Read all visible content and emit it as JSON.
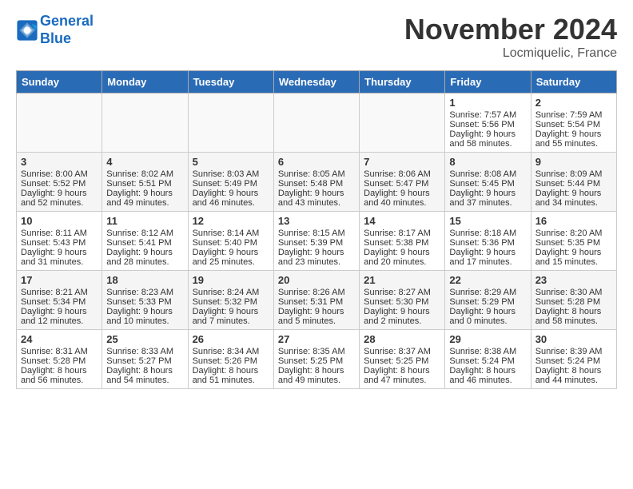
{
  "logo": {
    "line1": "General",
    "line2": "Blue"
  },
  "title": "November 2024",
  "location": "Locmiquelic, France",
  "headers": [
    "Sunday",
    "Monday",
    "Tuesday",
    "Wednesday",
    "Thursday",
    "Friday",
    "Saturday"
  ],
  "weeks": [
    [
      {
        "day": "",
        "content": ""
      },
      {
        "day": "",
        "content": ""
      },
      {
        "day": "",
        "content": ""
      },
      {
        "day": "",
        "content": ""
      },
      {
        "day": "",
        "content": ""
      },
      {
        "day": "1",
        "content": "Sunrise: 7:57 AM\nSunset: 5:56 PM\nDaylight: 9 hours and 58 minutes."
      },
      {
        "day": "2",
        "content": "Sunrise: 7:59 AM\nSunset: 5:54 PM\nDaylight: 9 hours and 55 minutes."
      }
    ],
    [
      {
        "day": "3",
        "content": "Sunrise: 8:00 AM\nSunset: 5:52 PM\nDaylight: 9 hours and 52 minutes."
      },
      {
        "day": "4",
        "content": "Sunrise: 8:02 AM\nSunset: 5:51 PM\nDaylight: 9 hours and 49 minutes."
      },
      {
        "day": "5",
        "content": "Sunrise: 8:03 AM\nSunset: 5:49 PM\nDaylight: 9 hours and 46 minutes."
      },
      {
        "day": "6",
        "content": "Sunrise: 8:05 AM\nSunset: 5:48 PM\nDaylight: 9 hours and 43 minutes."
      },
      {
        "day": "7",
        "content": "Sunrise: 8:06 AM\nSunset: 5:47 PM\nDaylight: 9 hours and 40 minutes."
      },
      {
        "day": "8",
        "content": "Sunrise: 8:08 AM\nSunset: 5:45 PM\nDaylight: 9 hours and 37 minutes."
      },
      {
        "day": "9",
        "content": "Sunrise: 8:09 AM\nSunset: 5:44 PM\nDaylight: 9 hours and 34 minutes."
      }
    ],
    [
      {
        "day": "10",
        "content": "Sunrise: 8:11 AM\nSunset: 5:43 PM\nDaylight: 9 hours and 31 minutes."
      },
      {
        "day": "11",
        "content": "Sunrise: 8:12 AM\nSunset: 5:41 PM\nDaylight: 9 hours and 28 minutes."
      },
      {
        "day": "12",
        "content": "Sunrise: 8:14 AM\nSunset: 5:40 PM\nDaylight: 9 hours and 25 minutes."
      },
      {
        "day": "13",
        "content": "Sunrise: 8:15 AM\nSunset: 5:39 PM\nDaylight: 9 hours and 23 minutes."
      },
      {
        "day": "14",
        "content": "Sunrise: 8:17 AM\nSunset: 5:38 PM\nDaylight: 9 hours and 20 minutes."
      },
      {
        "day": "15",
        "content": "Sunrise: 8:18 AM\nSunset: 5:36 PM\nDaylight: 9 hours and 17 minutes."
      },
      {
        "day": "16",
        "content": "Sunrise: 8:20 AM\nSunset: 5:35 PM\nDaylight: 9 hours and 15 minutes."
      }
    ],
    [
      {
        "day": "17",
        "content": "Sunrise: 8:21 AM\nSunset: 5:34 PM\nDaylight: 9 hours and 12 minutes."
      },
      {
        "day": "18",
        "content": "Sunrise: 8:23 AM\nSunset: 5:33 PM\nDaylight: 9 hours and 10 minutes."
      },
      {
        "day": "19",
        "content": "Sunrise: 8:24 AM\nSunset: 5:32 PM\nDaylight: 9 hours and 7 minutes."
      },
      {
        "day": "20",
        "content": "Sunrise: 8:26 AM\nSunset: 5:31 PM\nDaylight: 9 hours and 5 minutes."
      },
      {
        "day": "21",
        "content": "Sunrise: 8:27 AM\nSunset: 5:30 PM\nDaylight: 9 hours and 2 minutes."
      },
      {
        "day": "22",
        "content": "Sunrise: 8:29 AM\nSunset: 5:29 PM\nDaylight: 9 hours and 0 minutes."
      },
      {
        "day": "23",
        "content": "Sunrise: 8:30 AM\nSunset: 5:28 PM\nDaylight: 8 hours and 58 minutes."
      }
    ],
    [
      {
        "day": "24",
        "content": "Sunrise: 8:31 AM\nSunset: 5:28 PM\nDaylight: 8 hours and 56 minutes."
      },
      {
        "day": "25",
        "content": "Sunrise: 8:33 AM\nSunset: 5:27 PM\nDaylight: 8 hours and 54 minutes."
      },
      {
        "day": "26",
        "content": "Sunrise: 8:34 AM\nSunset: 5:26 PM\nDaylight: 8 hours and 51 minutes."
      },
      {
        "day": "27",
        "content": "Sunrise: 8:35 AM\nSunset: 5:25 PM\nDaylight: 8 hours and 49 minutes."
      },
      {
        "day": "28",
        "content": "Sunrise: 8:37 AM\nSunset: 5:25 PM\nDaylight: 8 hours and 47 minutes."
      },
      {
        "day": "29",
        "content": "Sunrise: 8:38 AM\nSunset: 5:24 PM\nDaylight: 8 hours and 46 minutes."
      },
      {
        "day": "30",
        "content": "Sunrise: 8:39 AM\nSunset: 5:24 PM\nDaylight: 8 hours and 44 minutes."
      }
    ]
  ]
}
